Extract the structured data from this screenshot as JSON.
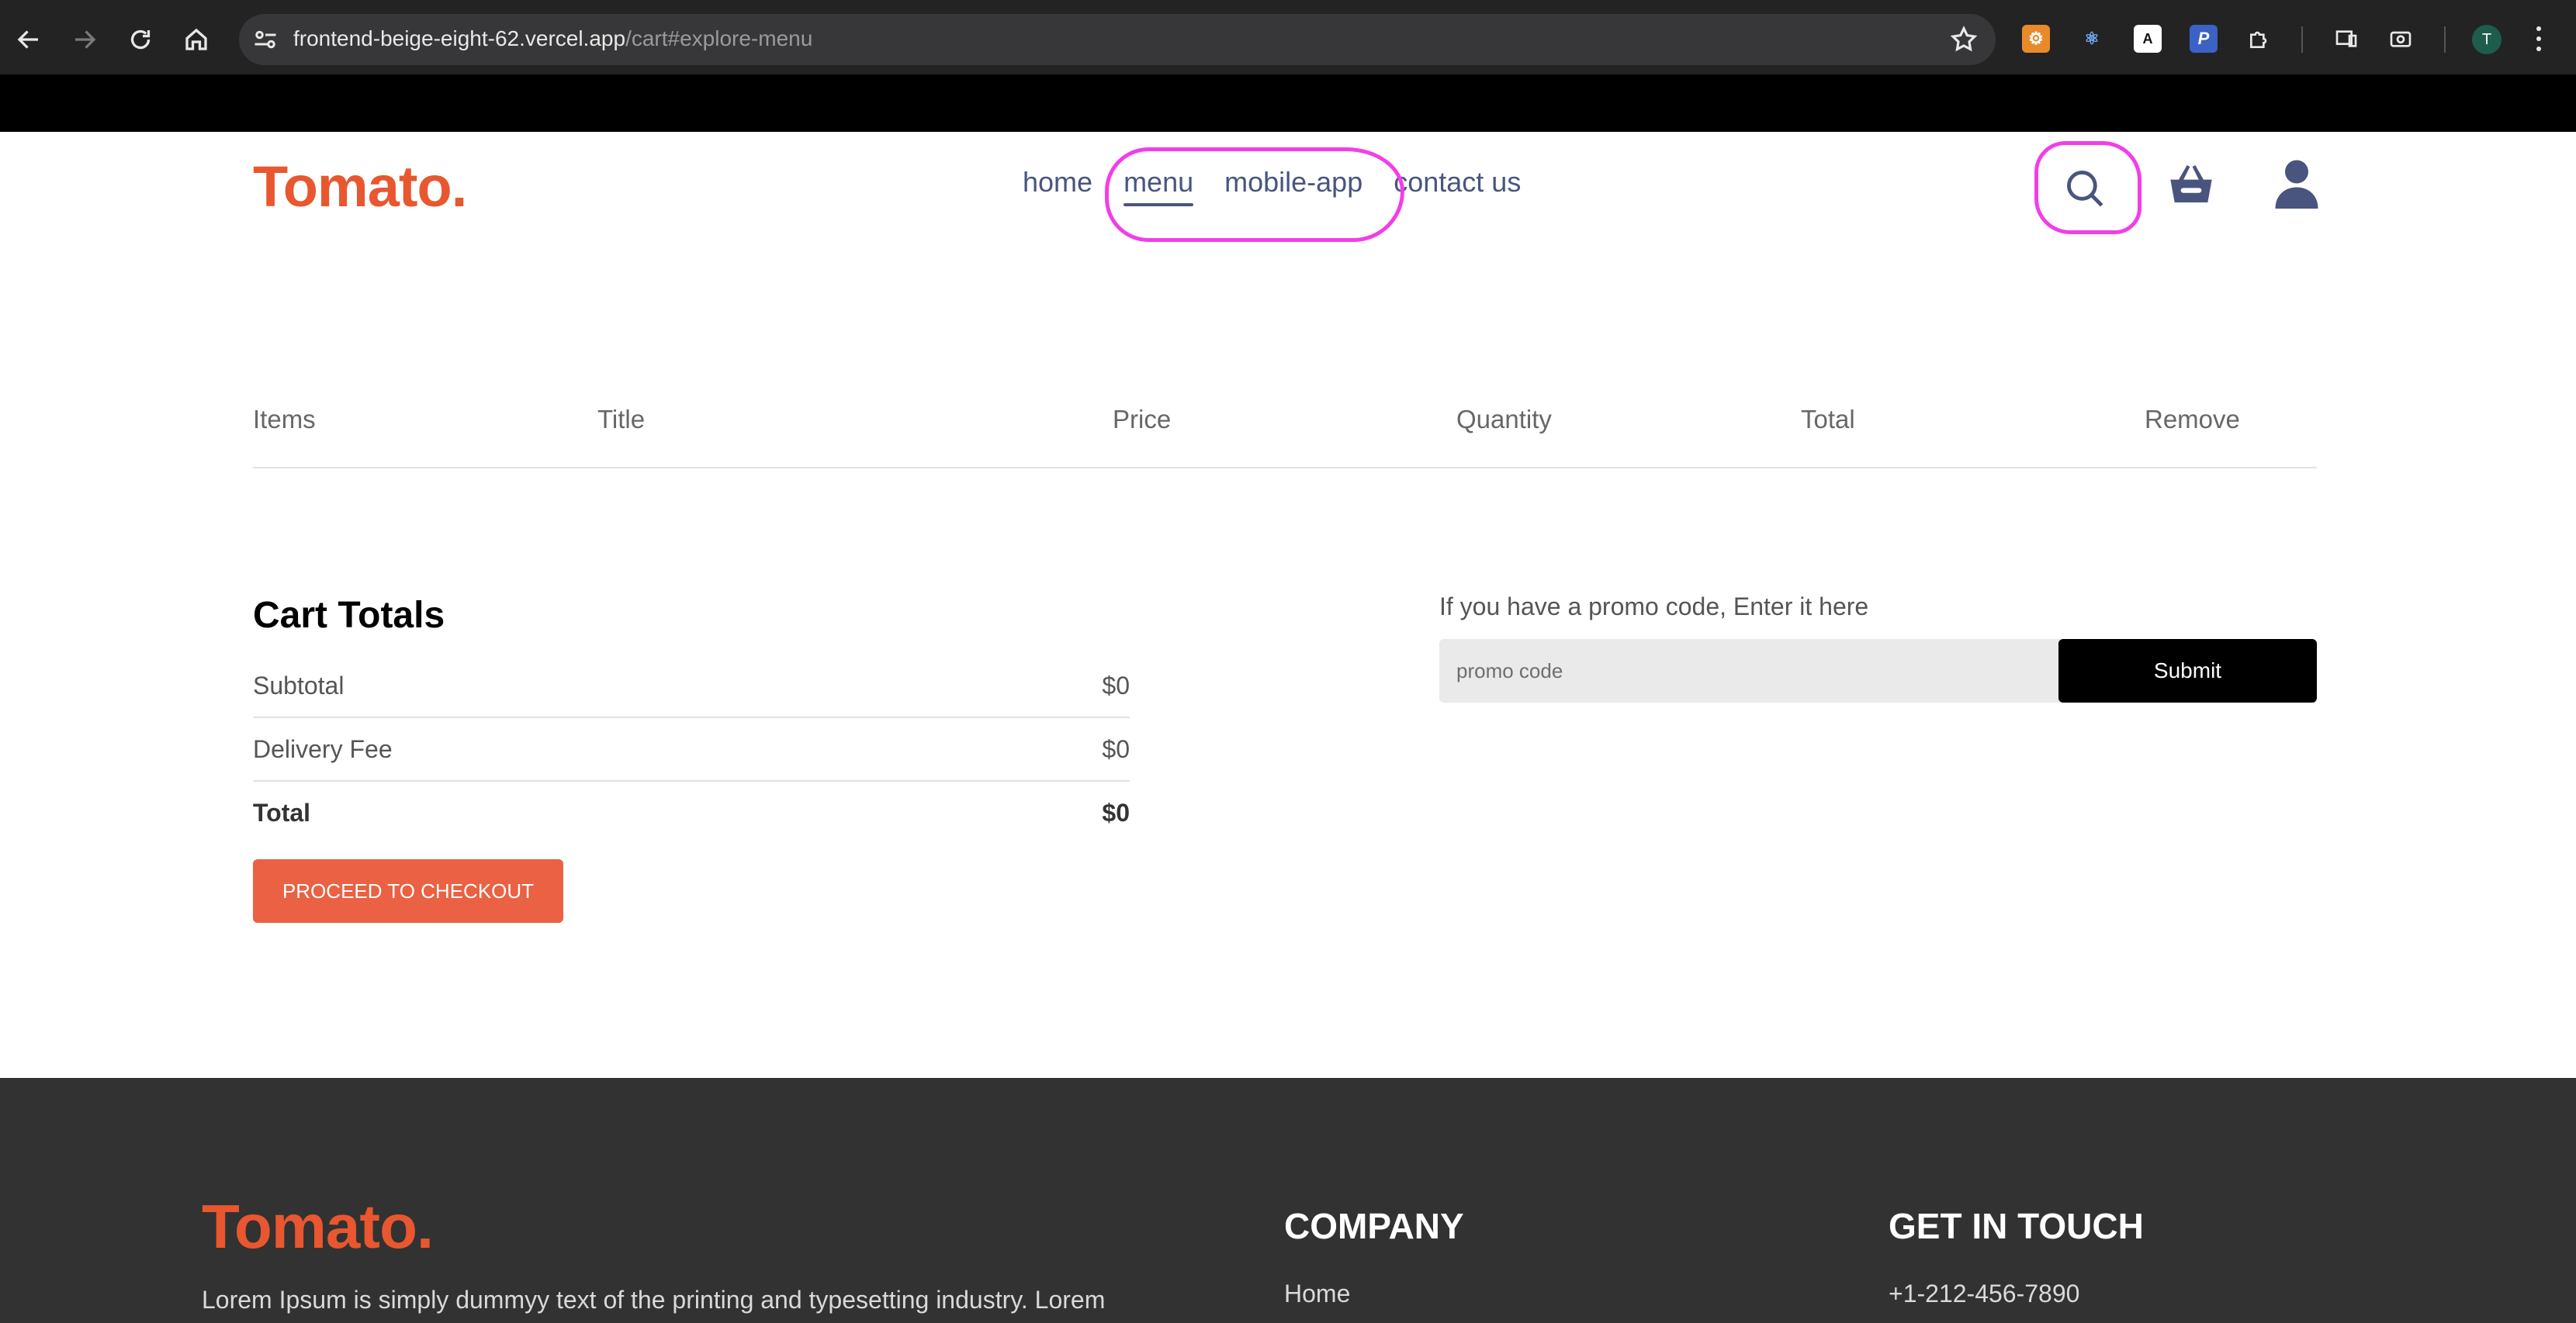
{
  "browser": {
    "url_host": "frontend-beige-eight-62.vercel.app",
    "url_path": "/cart#explore-menu",
    "profile_initial": "T"
  },
  "navbar": {
    "logo": "Tomato.",
    "links": [
      "home",
      "menu",
      "mobile-app",
      "contact us"
    ],
    "active_link": "menu",
    "annotation_color": "#f23ee8"
  },
  "cart_table": {
    "headers": [
      "Items",
      "Title",
      "Price",
      "Quantity",
      "Total",
      "Remove"
    ]
  },
  "cart_totals": {
    "title": "Cart Totals",
    "subtotal_label": "Subtotal",
    "subtotal_value": "$0",
    "delivery_label": "Delivery Fee",
    "delivery_value": "$0",
    "total_label": "Total",
    "total_value": "$0",
    "checkout_label": "PROCEED TO CHECKOUT"
  },
  "promo": {
    "label": "If you have a promo code, Enter it here",
    "placeholder": "promo code",
    "submit_label": "Submit"
  },
  "footer": {
    "logo": "Tomato.",
    "text": "Lorem Ipsum is simply dummyy text of the printing and typesetting industry. Lorem",
    "company_heading": "COMPANY",
    "company_first_item": "Home",
    "contact_heading": "GET IN TOUCH",
    "phone": "+1-212-456-7890"
  },
  "colors": {
    "brand": "#e8572f",
    "checkout_button": "#ea6143",
    "nav_text": "#49557e",
    "footer_bg": "#323232"
  }
}
